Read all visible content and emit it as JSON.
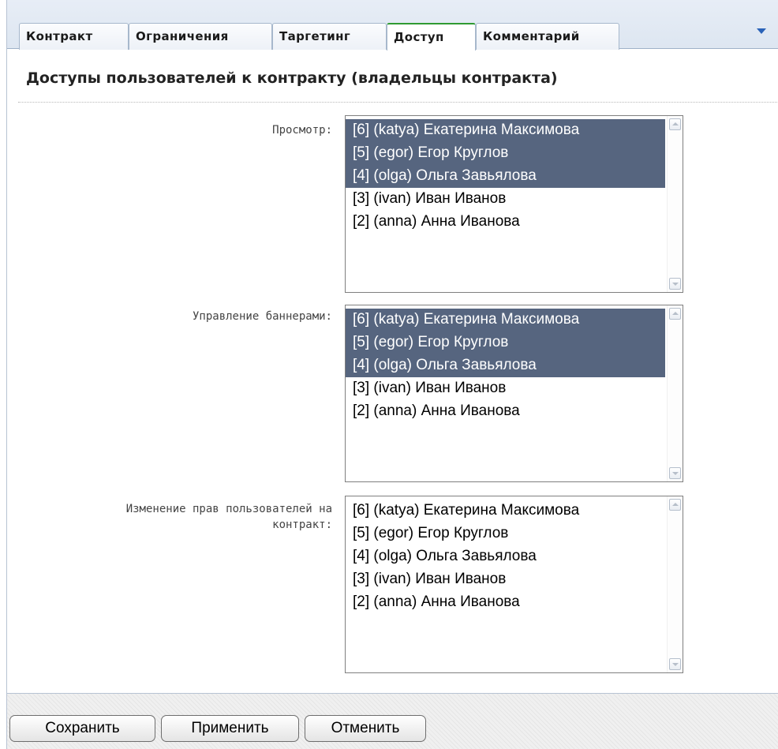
{
  "tabs": [
    {
      "label": "Контракт",
      "active": false
    },
    {
      "label": "Ограничения",
      "active": false
    },
    {
      "label": "Таргетинг",
      "active": false
    },
    {
      "label": "Доступ",
      "active": true
    },
    {
      "label": "Комментарий",
      "active": false
    }
  ],
  "tab_menu_icon": "chevron-down-icon",
  "section_title": "Доступы пользователей к контракту (владельцы контракта)",
  "fields": [
    {
      "label": "Просмотр:",
      "options": [
        {
          "text": "[6] (katya) Екатерина Максимова",
          "selected": true
        },
        {
          "text": "[5] (egor) Егор Круглов",
          "selected": true
        },
        {
          "text": "[4] (olga) Ольга Завьялова",
          "selected": true
        },
        {
          "text": "[3] (ivan) Иван Иванов",
          "selected": false
        },
        {
          "text": "[2] (anna) Анна Иванова",
          "selected": false
        }
      ]
    },
    {
      "label": "Управление баннерами:",
      "options": [
        {
          "text": "[6] (katya) Екатерина Максимова",
          "selected": true
        },
        {
          "text": "[5] (egor) Егор Круглов",
          "selected": true
        },
        {
          "text": "[4] (olga) Ольга Завьялова",
          "selected": true
        },
        {
          "text": "[3] (ivan) Иван Иванов",
          "selected": false
        },
        {
          "text": "[2] (anna) Анна Иванова",
          "selected": false
        }
      ]
    },
    {
      "label_line1": "Изменение прав пользователей на",
      "label_line2": "контракт:",
      "options": [
        {
          "text": "[6] (katya) Екатерина Максимова",
          "selected": false
        },
        {
          "text": "[5] (egor) Егор Круглов",
          "selected": false
        },
        {
          "text": "[4] (olga) Ольга Завьялова",
          "selected": false
        },
        {
          "text": "[3] (ivan) Иван Иванов",
          "selected": false
        },
        {
          "text": "[2] (anna) Анна Иванова",
          "selected": false
        }
      ]
    }
  ],
  "buttons": {
    "save": "Сохранить",
    "apply": "Применить",
    "cancel": "Отменить"
  },
  "colors": {
    "selected_option_bg": "#56657f",
    "active_tab_accent": "#2f9a32",
    "tab_menu_arrow": "#2a62b8"
  }
}
